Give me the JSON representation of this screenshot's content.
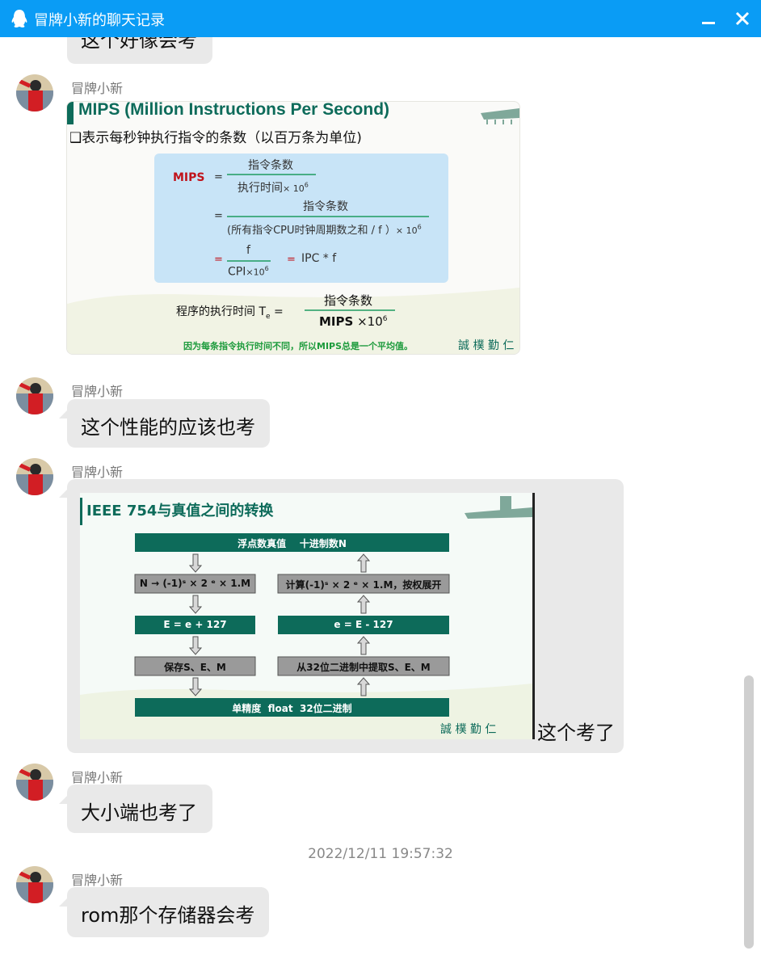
{
  "window": {
    "title": "冒牌小新的聊天记录"
  },
  "messages": [
    {
      "text": "这个好像会考"
    },
    {
      "sender": "冒牌小新",
      "image": {
        "title": "MIPS (Million Instructions Per Second)",
        "bullet": "❑表示每秒钟执行指令的条数（以百万条为单位)",
        "lhs": "MIPS",
        "eq": "=",
        "f1_num": "指令条数",
        "f1_den": "执行时间",
        "f1_factor": "× 10",
        "exp6": "6",
        "f2_num": "指令条数",
        "f2_den": "(所有指令CPU时钟周期数之和 / f ）",
        "f2_factor": "× 10",
        "f3_num": "f",
        "f3_den": "CPI",
        "f3_factor": "×10",
        "ipc": "IPC * f",
        "te_label": "程序的执行时间 T",
        "te_sub": "e",
        "te_eq": "=",
        "te_num": "指令条数",
        "te_den": "MIPS",
        "te_factor": "×10",
        "note": "因为每条指令执行时间不同，所以MIPS总是一个平均值。",
        "motto": "誠 樸 勤 仁"
      }
    },
    {
      "sender": "冒牌小新",
      "text": "这个性能的应该也考"
    },
    {
      "sender": "冒牌小新",
      "caption": "这个考了",
      "image": {
        "title": "IEEE 754与真值之间的转换",
        "top_box": "浮点数真值    十进制数N",
        "left_1": "N → (-1)ˢ × 2 ᵉ × 1.M",
        "left_2": "E = e + 127",
        "left_3": "保存S、E、M",
        "right_1": "计算(-1)ˢ × 2 ᵉ × 1.M，按权展开",
        "right_2": "e = E - 127",
        "right_3": "从32位二进制中提取S、E、M",
        "bottom_box": "单精度  float  32位二进制",
        "motto": "誠 樸 勤 仁"
      }
    },
    {
      "sender": "冒牌小新",
      "text": "大小端也考了"
    },
    {
      "timestamp": "2022/12/11 19:57:32"
    },
    {
      "sender": "冒牌小新",
      "text": "rom那个存储器会考"
    }
  ],
  "colors": {
    "titlebar": "#0a9cf5",
    "bubble": "#e9e9e9",
    "slide_green": "#0d6b5a",
    "slide_box_blue": "#c8e4f7",
    "mips_red": "#c0131b"
  }
}
